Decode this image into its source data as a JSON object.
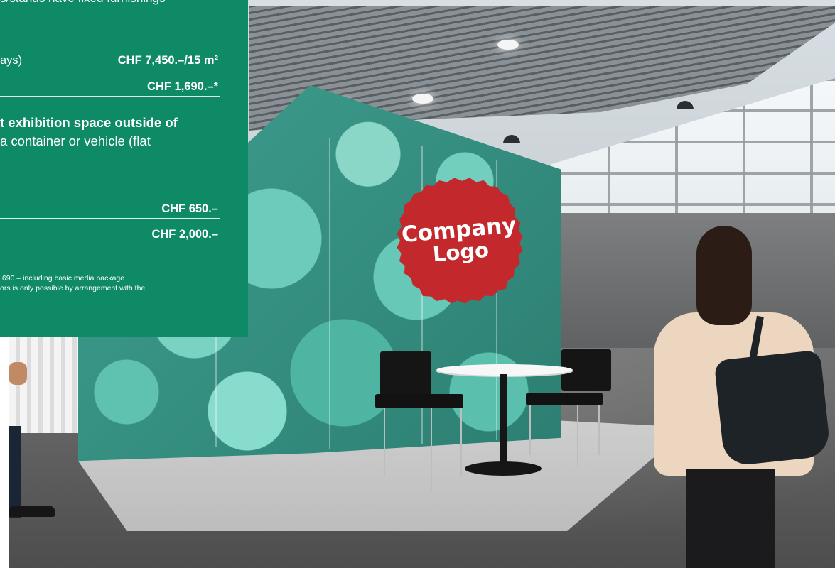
{
  "panel": {
    "intro_text": "s/stands have fixed furnishings",
    "rows_top": [
      {
        "label": "ays)",
        "price": "CHF 7,450.–/15 m²"
      },
      {
        "label": "",
        "price": "CHF 1,690.–*"
      }
    ],
    "heading": {
      "line1": "t exhibition space outside of",
      "line2": "a container or vehicle (flat"
    },
    "rows_bottom": [
      {
        "label": "",
        "price": "CHF 650.–"
      },
      {
        "label": "",
        "price": "CHF 2,000.–"
      }
    ],
    "footnotes": [
      ",690.– including basic media package",
      "ors is only possible by arrangement with the"
    ]
  },
  "scene": {
    "logo_text_line1": "Company",
    "logo_text_line2": "Logo"
  },
  "colors": {
    "panel_green": "#0f8a67",
    "seal_red": "#c2282c",
    "backdrop_teal": "#5fc2b0"
  }
}
